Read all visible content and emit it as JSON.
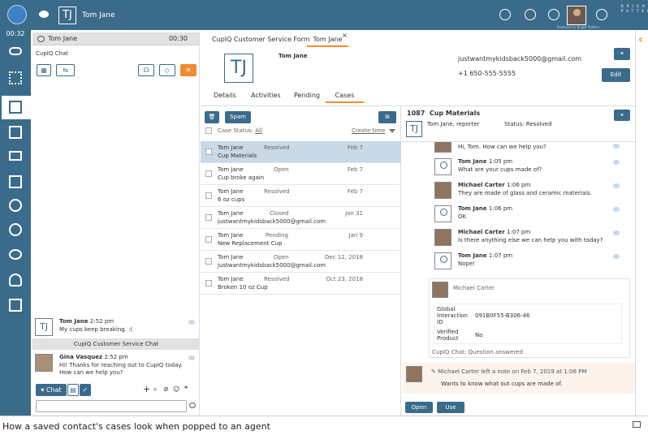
{
  "topbar": {
    "initials": "TJ",
    "title": "Tom Jane",
    "powered_by": "Powered by Bright Pattern",
    "logo": "BRIGHT PATTERN"
  },
  "leftnav": {
    "timer": "00:32"
  },
  "chat": {
    "header_name": "Tom Jane",
    "header_time": "00:30",
    "channel": "CupIQ Chat",
    "messages": [
      {
        "initials": "TJ",
        "name": "Tom Jane",
        "time": "2:52 pm",
        "text": "My cups keep breaking. :("
      },
      {
        "initials": "",
        "name": "Gina Vasquez",
        "time": "2:52 pm",
        "text": "Hi! Thanks for reaching out to CupIQ today. How can we help you?"
      }
    ],
    "divider_label": "CupIQ Customer Service Chat",
    "chat_button": "Chat"
  },
  "main": {
    "tabs": [
      "CupIQ Customer Service Form",
      "Tom Jane"
    ],
    "close_glyph": "×",
    "contact": {
      "initials": "TJ",
      "name": "Tom Jane",
      "email": "justwantmykidsback5000@gmail.com",
      "phone": "+1 650-555-5555",
      "edit_label": "Edit"
    },
    "subtabs": [
      "Details",
      "Activities",
      "Pending",
      "Cases"
    ],
    "spam_label": "Spam",
    "case_status_label": "Case Status:",
    "case_status_value": "All",
    "sort_label": "Create time",
    "cases": [
      {
        "name": "Tom Jane",
        "status": "Resolved",
        "date": "Feb 7",
        "subject": "Cup Materials"
      },
      {
        "name": "Tom Jane",
        "status": "Open",
        "date": "Feb 7",
        "subject": "Cup broke again"
      },
      {
        "name": "Tom Jane",
        "status": "Resolved",
        "date": "Feb 7",
        "subject": "6 oz cups"
      },
      {
        "name": "Tom Jane",
        "status": "Closed",
        "date": "Jan 31",
        "subject": "justwantmykidsback5000@gmail.com"
      },
      {
        "name": "Tom Jane",
        "status": "Pending",
        "date": "Jan 9",
        "subject": "New Replacement Cup"
      },
      {
        "name": "Tom Jane",
        "status": "Open",
        "date": "Dec 12, 2018",
        "subject": "justwantmykidsback5000@gmail.com"
      },
      {
        "name": "Tom Jane",
        "status": "Resolved",
        "date": "Oct 23, 2018",
        "subject": "Broken 10 oz Cup"
      }
    ],
    "detail": {
      "case_number": "1087",
      "case_title": "Cup Materials",
      "initials": "TJ",
      "reporter": "Tom Jane, reporter",
      "status": "Status: Resolved",
      "messages": [
        {
          "name": "",
          "time": "",
          "text": "Hi, Tom. How can we help you?",
          "photo": true
        },
        {
          "name": "Tom Jane",
          "time": "1:05 pm",
          "text": "What are your cups made of?",
          "photo": false
        },
        {
          "name": "Michael Carter",
          "time": "1:06 pm",
          "text": "They are made of glass and ceramic materials.",
          "photo": true
        },
        {
          "name": "Tom Jane",
          "time": "1:06 pm",
          "text": "OK",
          "photo": false
        },
        {
          "name": "Michael Carter",
          "time": "1:07 pm",
          "text": "Is there anything else we can help you with today?",
          "photo": true
        },
        {
          "name": "Tom Jane",
          "time": "1:07 pm",
          "text": "Nope!",
          "photo": false
        }
      ],
      "wrap_agent": "Michael Carter",
      "wrap_fields": [
        {
          "label": "Global Interaction ID",
          "value": "091B0F55-B306-46"
        },
        {
          "label": "Verified Product",
          "value": "No"
        }
      ],
      "wrap_footer": "CupIQ Chat: Question answered",
      "note_header": "Michael Carter left a note on Feb 7, 2019 at 1:06 PM",
      "note_text": "Wants to know what out cups are made of.",
      "open_label": "Open",
      "use_label": "Use"
    }
  },
  "caption": "How a saved contact's cases look when popped to an agent",
  "colors": {
    "primary": "#3b6b8b",
    "accent": "#f08c30",
    "selected_row": "#c9d9e6"
  }
}
